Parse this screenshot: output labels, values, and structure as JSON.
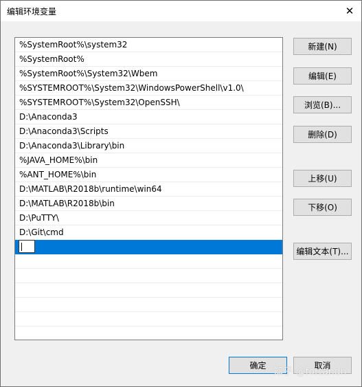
{
  "window": {
    "title": "编辑环境变量"
  },
  "paths": [
    "%SystemRoot%\\system32",
    "%SystemRoot%",
    "%SystemRoot%\\System32\\Wbem",
    "%SYSTEMROOT%\\System32\\WindowsPowerShell\\v1.0\\",
    "%SYSTEMROOT%\\System32\\OpenSSH\\",
    "D:\\Anaconda3",
    "D:\\Anaconda3\\Scripts",
    "D:\\Anaconda3\\Library\\bin",
    "%JAVA_HOME%\\bin",
    "%ANT_HOME%\\bin",
    "D:\\MATLAB\\R2018b\\runtime\\win64",
    "D:\\MATLAB\\R2018b\\bin",
    "D:\\PuTTY\\",
    "D:\\Git\\cmd"
  ],
  "buttons": {
    "new": "新建(N)",
    "edit": "编辑(E)",
    "browse": "浏览(B)...",
    "delete": "删除(D)",
    "move_up": "上移(U)",
    "move_down": "下移(O)",
    "edit_text": "编辑文本(T)...",
    "ok": "确定",
    "cancel": "取消"
  },
  "watermark": "知乎 @fortandh",
  "colors": {
    "selection": "#0078d7",
    "button_bg": "#e1e1e1"
  }
}
